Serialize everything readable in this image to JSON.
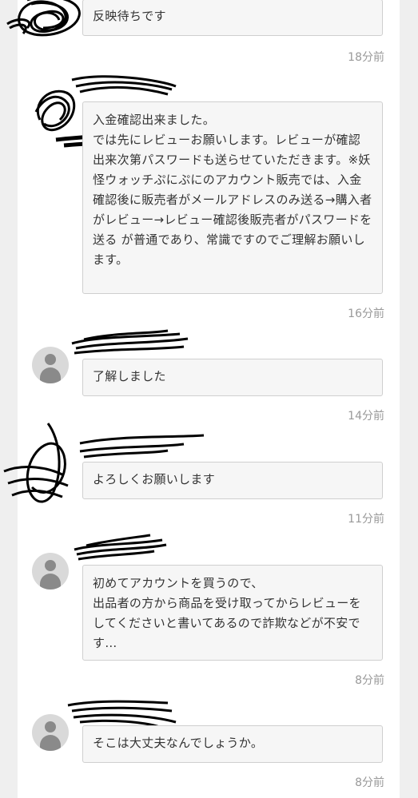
{
  "messages": [
    {
      "text": "反映待ちです",
      "time": "18分前",
      "avatar": "redacted-avatar"
    },
    {
      "text": "入金確認出来ました。\nでは先にレビューお願いします。レビューが確認出来次第パスワードも送らせていただきます。※妖怪ウォッチぷにぷにのアカウント販売では、入金確認後に販売者がメールアドレスのみ送る→購入者がレビュー→レビュー確認後販売者がパスワードを送る が普通であり、常識ですのでご理解お願いします。",
      "time": "16分前",
      "avatar": "redacted-avatar"
    },
    {
      "text": "了解しました",
      "time": "14分前",
      "avatar": "default-user-icon"
    },
    {
      "text": "よろしくお願いします",
      "time": "11分前",
      "avatar": "redacted-avatar"
    },
    {
      "text": "初めてアカウントを買うので、\n出品者の方から商品を受け取ってからレビューをしてくださいと書いてあるので詐欺などが不安です…",
      "time": "8分前",
      "avatar": "default-user-icon"
    },
    {
      "text": "そこは大丈夫なんでしょうか。",
      "time": "8分前",
      "avatar": "default-user-icon"
    }
  ]
}
